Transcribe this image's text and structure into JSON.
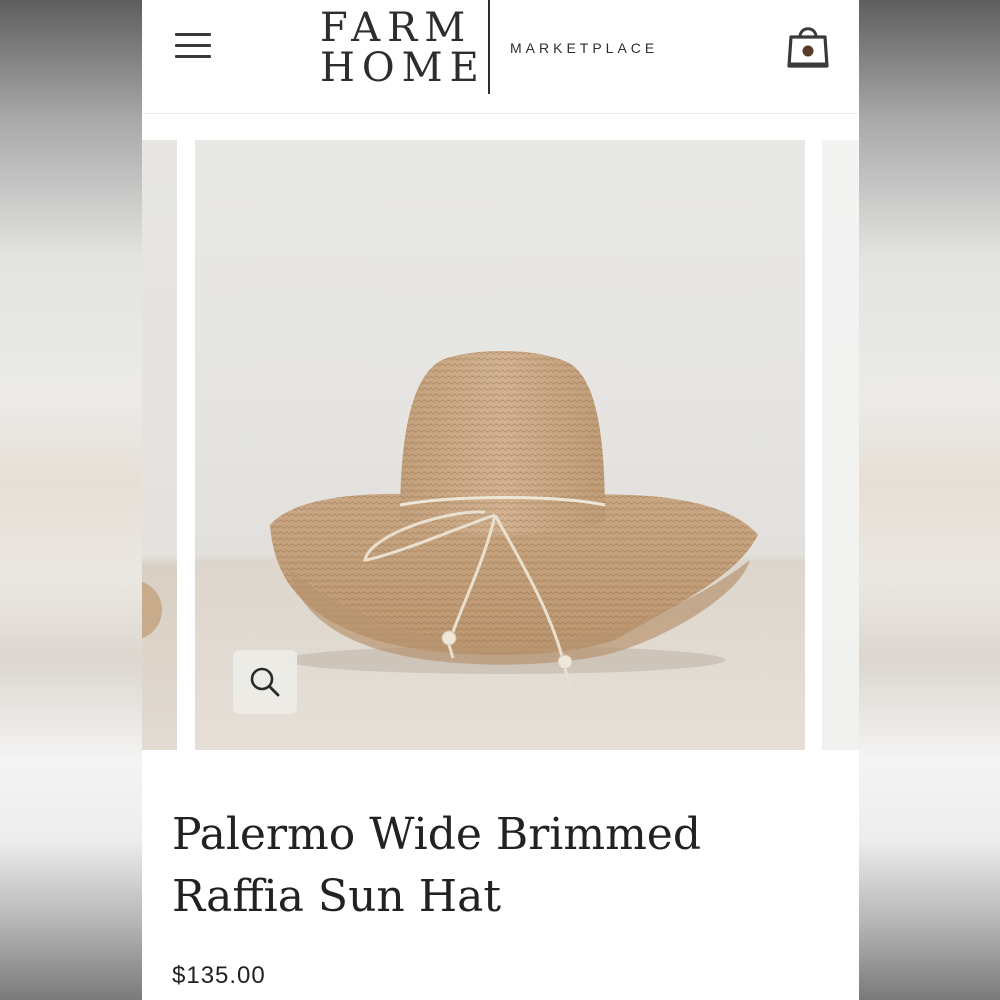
{
  "header": {
    "logo_line1": "FARM",
    "logo_line2": "HOME",
    "logo_tagline": "MARKETPLACE",
    "menu_icon": "hamburger-menu-icon",
    "cart_icon": "shopping-bag-icon"
  },
  "gallery": {
    "image_subject": "raffia sun hat",
    "zoom_icon": "magnifier-icon"
  },
  "product": {
    "title": "Palermo Wide Brimmed Raffia Sun Hat",
    "price": "$135.00"
  },
  "colors": {
    "text": "#222222",
    "background": "#ffffff",
    "hat": "#c9a989"
  }
}
